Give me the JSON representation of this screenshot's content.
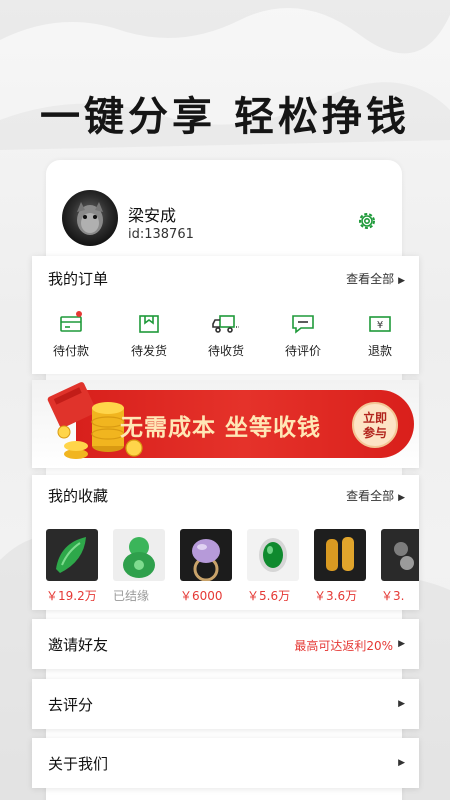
{
  "headline": "一键分享  轻松挣钱",
  "profile": {
    "name": "梁安成",
    "id": "id:138761"
  },
  "orders": {
    "title": "我的订单",
    "more": "查看全部",
    "items": [
      {
        "label": "待付款",
        "icon": "wallet-icon"
      },
      {
        "label": "待发货",
        "icon": "box-icon"
      },
      {
        "label": "待收货",
        "icon": "truck-icon"
      },
      {
        "label": "待评价",
        "icon": "comment-icon"
      },
      {
        "label": "退款",
        "icon": "refund-icon"
      }
    ]
  },
  "banner": {
    "text": "无需成本 坐等收钱",
    "button": "立即\n参与"
  },
  "favorites": {
    "title": "我的收藏",
    "more": "查看全部",
    "items": [
      {
        "price": "￥19.2万"
      },
      {
        "price": "已结缘"
      },
      {
        "price": "￥6000"
      },
      {
        "price": "￥5.6万"
      },
      {
        "price": "￥3.6万"
      },
      {
        "price": "￥3."
      }
    ]
  },
  "rows": [
    {
      "label": "邀请好友",
      "right": "最高可达返利20%"
    },
    {
      "label": "去评分",
      "right": ""
    },
    {
      "label": "关于我们",
      "right": ""
    }
  ],
  "colors": {
    "accent_red": "#e53935",
    "jade_green": "#1f9a3a",
    "banner_red": "#d8201c"
  }
}
